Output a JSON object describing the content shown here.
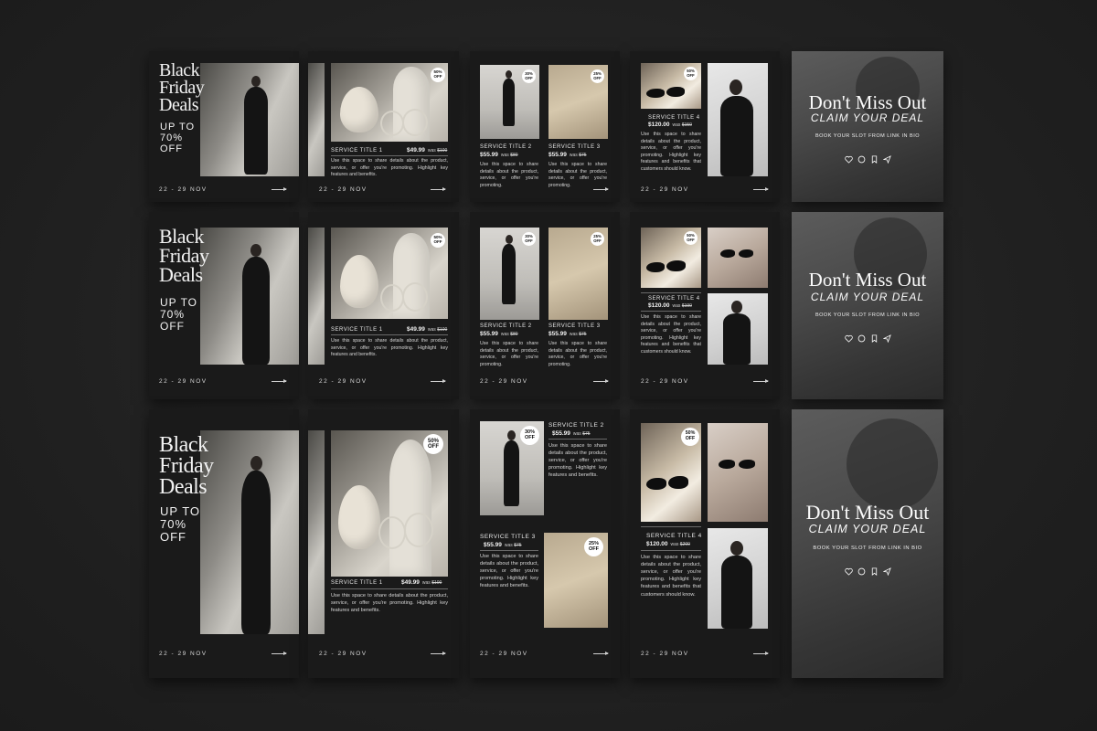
{
  "bf": {
    "line1": "Black",
    "line2": "Friday",
    "line3": "Deals",
    "up": "UP TO",
    "pct": "70%",
    "off": "OFF"
  },
  "date": "22 - 29 NOV",
  "badges": {
    "b50": "50%",
    "b30": "30%",
    "b25": "25%",
    "off": "OFF"
  },
  "services": {
    "s1": {
      "title": "SERVICE TITLE 1",
      "price": "$49.99",
      "was": "was",
      "old": "$100"
    },
    "s2": {
      "title": "SERVICE TITLE 2",
      "price": "$55.99",
      "was": "was",
      "old": "$80"
    },
    "s2b": {
      "title": "SERVICE TITLE 2",
      "price": "$55.99",
      "was": "was",
      "old": "$75"
    },
    "s3": {
      "title": "SERVICE TITLE 3",
      "price": "$55.99",
      "was": "was",
      "old": "$75"
    },
    "s4": {
      "title": "SERVICE TITLE 4",
      "price": "$120.00",
      "was": "was",
      "old": "$150"
    },
    "s4b": {
      "title": "SERVICE TITLE 4",
      "price": "$120.00",
      "was": "was",
      "old": "$190"
    },
    "s4c": {
      "title": "SERVICE TITLE 4",
      "price": "$120.00",
      "was": "was",
      "old": "$200"
    }
  },
  "desc": {
    "long": "Use this space to share details about the product, service, or offer you're promoting. Highlight key features and benefits.",
    "short": "Use this space to share details about the product, service, or offer you're promoting.",
    "s4": "Use this space to share details about the product, service, or offer you're promoting. Highlight key features and benefits that customers should know."
  },
  "promo": {
    "title": "Don't Miss Out",
    "claim": "CLAIM YOUR DEAL",
    "book": "BOOK YOUR SLOT FROM LINK IN BIO"
  },
  "icons": [
    "heart-icon",
    "comment-icon",
    "bookmark-icon",
    "send-icon"
  ],
  "colors": {
    "background": "#232323",
    "card": "#1a1a1a",
    "text": "#f2f2f2",
    "badge": "#ffffff"
  }
}
